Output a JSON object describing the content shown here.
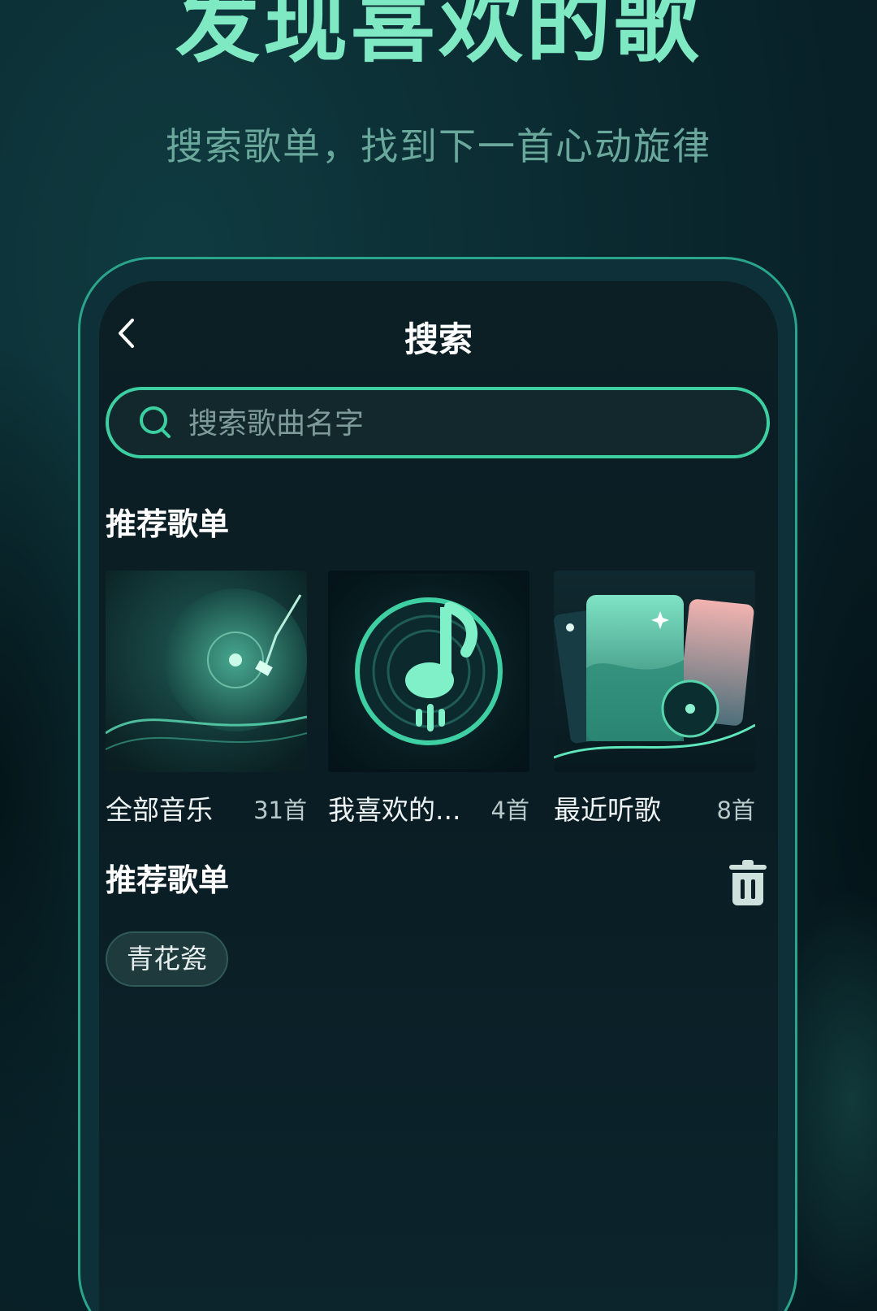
{
  "hero": {
    "title": "发现喜欢的歌",
    "subtitle": "搜索歌单，找到下一首心动旋律"
  },
  "screen": {
    "title": "搜索",
    "search": {
      "placeholder": "搜索歌曲名字"
    },
    "recommended_section": {
      "title": "推荐歌单",
      "playlists": [
        {
          "name": "全部音乐",
          "count": "31首",
          "cover_icon": "turntable-cover-icon"
        },
        {
          "name": "我喜欢的...",
          "count": "4首",
          "cover_icon": "music-note-vinyl-cover-icon"
        },
        {
          "name": "最近听歌",
          "count": "8首",
          "cover_icon": "cards-landscape-cover-icon"
        }
      ]
    },
    "history_section": {
      "title": "推荐歌单",
      "tags": [
        "青花瓷"
      ]
    }
  },
  "colors": {
    "accent": "#3ccfa0",
    "hero_title": "#7ee9c3",
    "background": "#0b2d33"
  }
}
